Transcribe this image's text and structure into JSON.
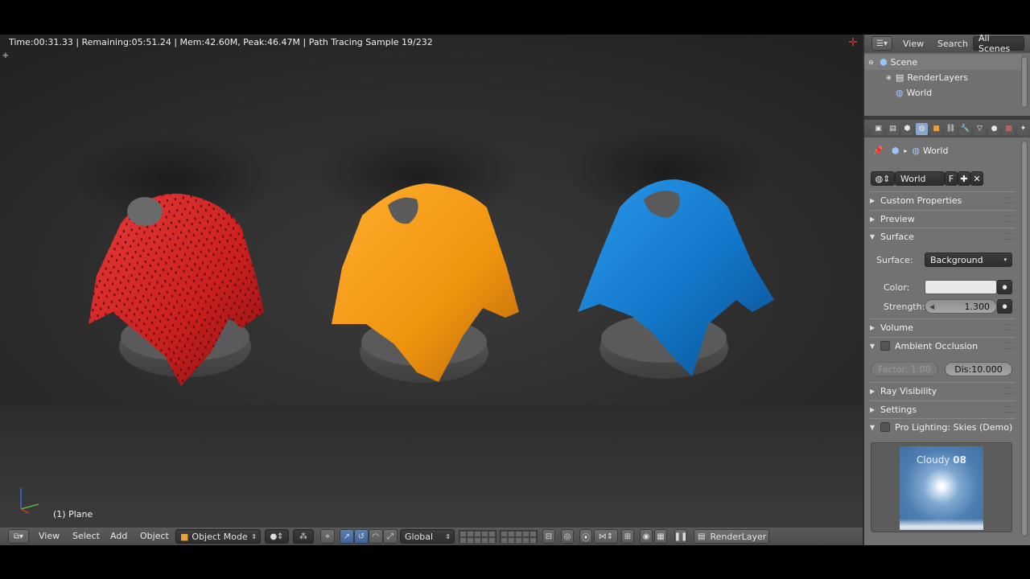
{
  "viewport": {
    "status": "Time:00:31.33 | Remaining:05:51.24 | Mem:42.60M, Peak:46.47M | Path Tracing Sample 19/232",
    "object_name": "(1) Plane"
  },
  "header": {
    "menus": [
      "View",
      "Select",
      "Add",
      "Object"
    ],
    "mode": "Object Mode",
    "orientation": "Global",
    "render_layer": "RenderLayer"
  },
  "outliner": {
    "menus": [
      "View",
      "Search"
    ],
    "display_mode": "All Scenes",
    "items": [
      "Scene",
      "RenderLayers",
      "World"
    ]
  },
  "properties": {
    "breadcrumb": "World",
    "datablock_name": "World",
    "fake_user": "F",
    "panels": {
      "custom_properties": "Custom Properties",
      "preview": "Preview",
      "surface": "Surface",
      "volume": "Volume",
      "ambient_occlusion": "Ambient Occlusion",
      "ray_visibility": "Ray Visibility",
      "settings": "Settings",
      "pro_lighting": "Pro Lighting: Skies (Demo)"
    },
    "surface": {
      "surface_label": "Surface:",
      "surface_value": "Background",
      "color_label": "Color:",
      "color_value": "#e8e8e8",
      "strength_label": "Strength:",
      "strength_value": "1.300"
    },
    "ao": {
      "factor": "Factor: 1.00",
      "distance": "Dis:10.000"
    },
    "sky_preview": {
      "name": "Cloudy",
      "number": "08"
    }
  },
  "colors": {
    "cloth_red": "#d42626",
    "cloth_orange": "#f29a1c",
    "cloth_blue": "#1a7fd0",
    "ui_panel": "#727272",
    "active_tab": "#8aa7cf"
  }
}
